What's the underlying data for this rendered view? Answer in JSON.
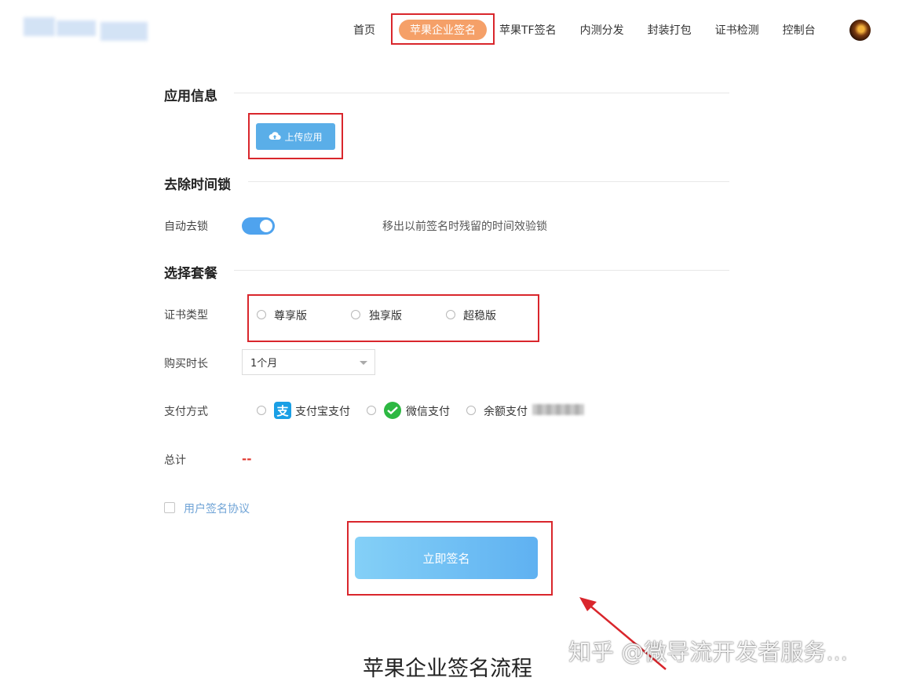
{
  "header": {
    "nav": [
      {
        "label": "首页",
        "active": false
      },
      {
        "label": "苹果企业签名",
        "active": true
      },
      {
        "label": "苹果TF签名",
        "active": false
      },
      {
        "label": "内测分发",
        "active": false
      },
      {
        "label": "封装打包",
        "active": false
      },
      {
        "label": "证书检测",
        "active": false
      },
      {
        "label": "控制台",
        "active": false
      }
    ]
  },
  "app_info": {
    "title": "应用信息",
    "upload_label": "上传应用"
  },
  "time_lock": {
    "title": "去除时间锁",
    "auto_label": "自动去锁",
    "toggle_on": true,
    "hint": "移出以前签名时残留的时间效验锁"
  },
  "package": {
    "title": "选择套餐",
    "cert_label": "证书类型",
    "cert_options": [
      "尊享版",
      "独享版",
      "超稳版"
    ],
    "duration_label": "购买时长",
    "duration_value": "1个月",
    "payment_label": "支付方式",
    "payment_options": [
      "支付宝支付",
      "微信支付",
      "余额支付"
    ],
    "total_label": "总计",
    "total_value": "--"
  },
  "agreement_label": "用户签名协议",
  "sign_button": "立即签名",
  "flow_title": "苹果企业签名流程",
  "watermark": "知乎 @微导流开发者服务...",
  "colors": {
    "accent": "#5aaee8",
    "nav_active": "#f5a068",
    "highlight": "#d9262c",
    "total": "#e0332b"
  }
}
